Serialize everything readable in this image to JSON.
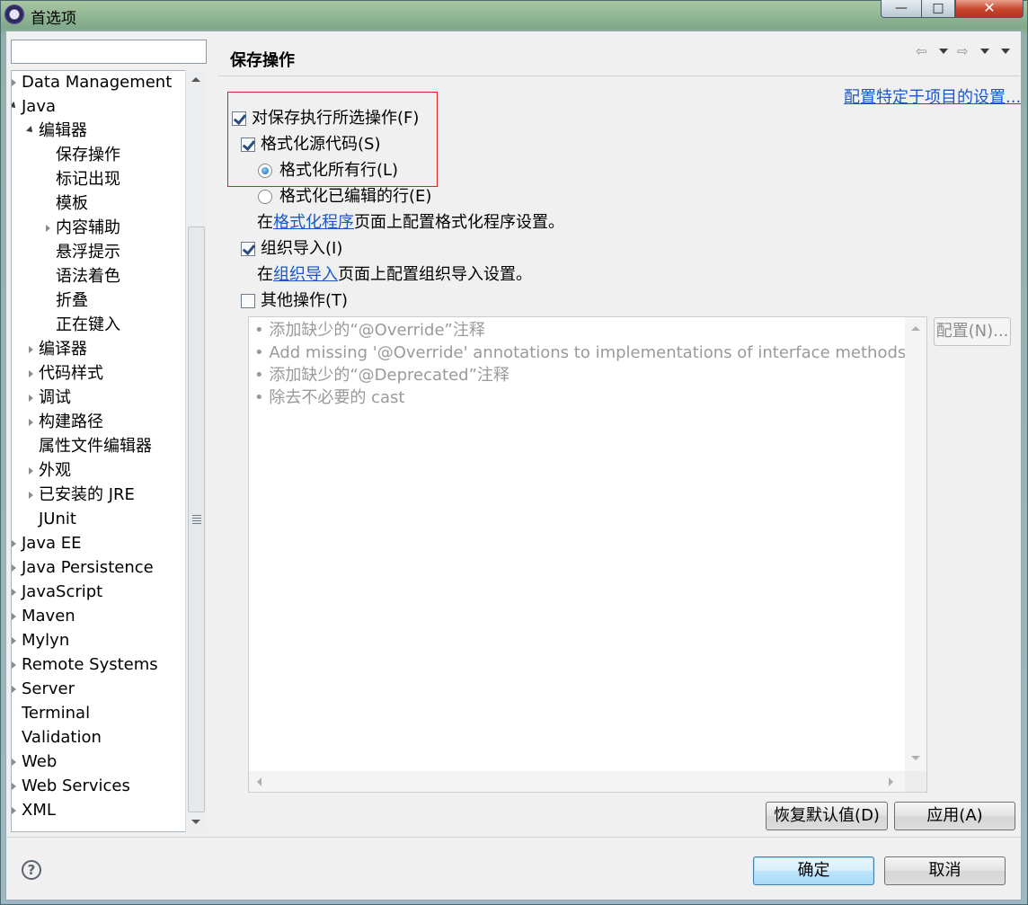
{
  "window": {
    "title": "首选项",
    "close_glyph": "✕",
    "max_glyph": "□",
    "min_glyph": "—"
  },
  "sidebar": {
    "filter_placeholder": "",
    "items": [
      {
        "label": "Data Management",
        "icon": "chevron-right-icon"
      },
      {
        "label": "Java",
        "icon": "chevron-down-icon"
      },
      {
        "label": "编辑器",
        "icon": "chevron-down-icon"
      },
      {
        "label": "保存操作"
      },
      {
        "label": "标记出现"
      },
      {
        "label": "模板"
      },
      {
        "label": "内容辅助",
        "icon": "chevron-right-icon"
      },
      {
        "label": "悬浮提示"
      },
      {
        "label": "语法着色"
      },
      {
        "label": "折叠"
      },
      {
        "label": "正在键入"
      },
      {
        "label": "编译器",
        "icon": "chevron-right-icon"
      },
      {
        "label": "代码样式",
        "icon": "chevron-right-icon"
      },
      {
        "label": "调试",
        "icon": "chevron-right-icon"
      },
      {
        "label": "构建路径",
        "icon": "chevron-right-icon"
      },
      {
        "label": "属性文件编辑器"
      },
      {
        "label": "外观",
        "icon": "chevron-right-icon"
      },
      {
        "label": "已安装的 JRE",
        "icon": "chevron-right-icon"
      },
      {
        "label": "JUnit"
      },
      {
        "label": "Java EE",
        "icon": "chevron-right-icon"
      },
      {
        "label": "Java Persistence",
        "icon": "chevron-right-icon"
      },
      {
        "label": "JavaScript",
        "icon": "chevron-right-icon"
      },
      {
        "label": "Maven",
        "icon": "chevron-right-icon"
      },
      {
        "label": "Mylyn",
        "icon": "chevron-right-icon"
      },
      {
        "label": "Remote Systems",
        "icon": "chevron-right-icon"
      },
      {
        "label": "Server",
        "icon": "chevron-right-icon"
      },
      {
        "label": "Terminal"
      },
      {
        "label": "Validation"
      },
      {
        "label": "Web",
        "icon": "chevron-right-icon"
      },
      {
        "label": "Web Services",
        "icon": "chevron-right-icon"
      },
      {
        "label": "XML",
        "icon": "chevron-right-icon"
      }
    ]
  },
  "page": {
    "title": "保存操作",
    "project_link": "配置特定于项目的设置...",
    "perform_on_save": {
      "label": "对保存执行所选操作(F)",
      "checked": true
    },
    "format_source": {
      "label": "格式化源代码(S)",
      "checked": true
    },
    "format_all_lines": {
      "label": "格式化所有行(L)",
      "selected": true
    },
    "format_edited_lines": {
      "label": "格式化已编辑的行(E)",
      "selected": false
    },
    "formatter_note": {
      "prefix": "在",
      "link": "格式化程序",
      "suffix": "页面上配置格式化程序设置。"
    },
    "organize_imports": {
      "label": "组织导入(I)",
      "checked": true
    },
    "imports_note": {
      "prefix": "在",
      "link": "组织导入",
      "suffix": "页面上配置组织导入设置。"
    },
    "other_actions": {
      "label": "其他操作(T)",
      "checked": false
    },
    "other_actions_list": [
      "• 添加缺少的“@Override”注释",
      "• Add missing '@Override' annotations to implementations of interface methods",
      "• 添加缺少的“@Deprecated”注释",
      "• 除去不必要的 cast"
    ],
    "configure_button": "配置(N)...",
    "restore_defaults_button": "恢复默认值(D)",
    "apply_button": "应用(A)"
  },
  "footer": {
    "help_glyph": "?",
    "ok_button": "确定",
    "cancel_button": "取消"
  },
  "colors": {
    "link": "#1a58c8",
    "highlight_box": "#e02020"
  }
}
